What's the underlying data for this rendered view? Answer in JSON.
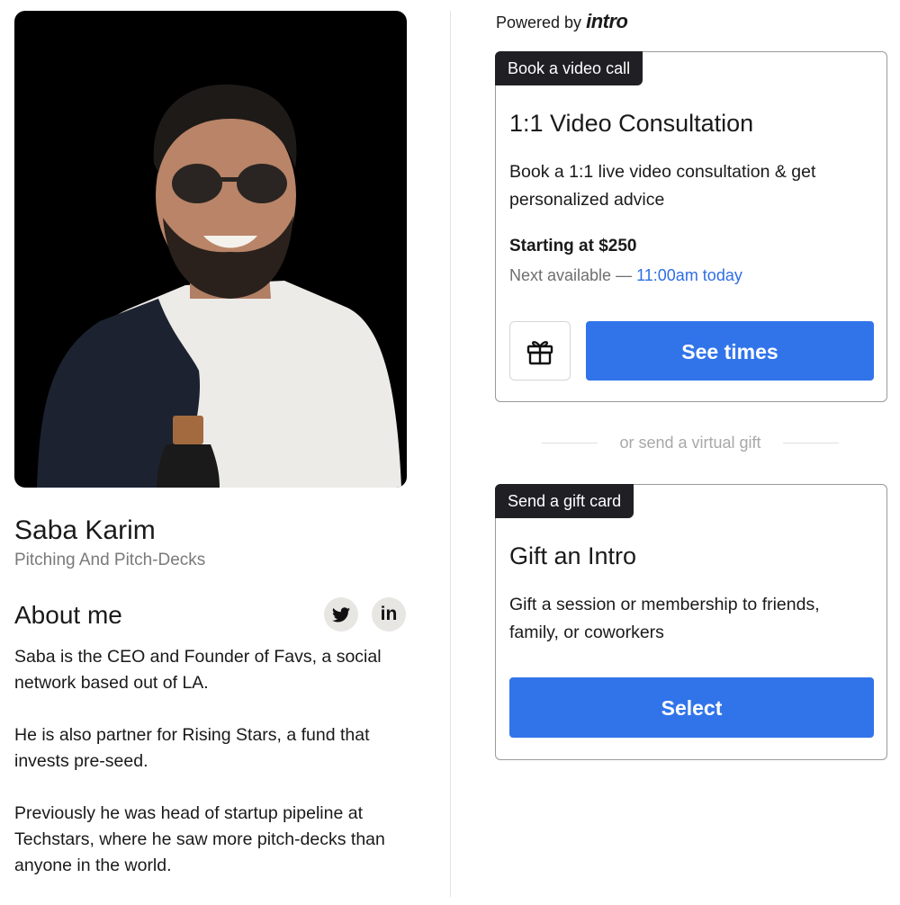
{
  "profile": {
    "name": "Saba Karim",
    "subtitle": "Pitching And Pitch-Decks"
  },
  "about": {
    "heading": "About me",
    "social_twitter_icon": "twitter-icon",
    "social_linkedin_label": "in",
    "bio": [
      "Saba is the CEO and Founder of Favs, a social network based out of LA.",
      "He is also partner for Rising Stars, a fund that invests pre-seed.",
      "Previously he was head of startup pipeline at Techstars, where he saw more pitch-decks than anyone in the world."
    ]
  },
  "powered": {
    "prefix": "Powered by",
    "brand": "intro"
  },
  "video_card": {
    "tag": "Book a video call",
    "title": "1:1 Video Consultation",
    "description": "Book a 1:1 live video consultation & get personalized advice",
    "price": "Starting at $250",
    "next_available_prefix": "Next available —",
    "next_available_time": "11:00am today",
    "gift_icon": "gift-icon",
    "button_label": "See times"
  },
  "divider_text": "or send a virtual gift",
  "gift_card": {
    "tag": "Send a gift card",
    "title": "Gift an Intro",
    "description": "Gift a session or membership to friends, family, or coworkers",
    "button_label": "Select"
  },
  "colors": {
    "accent": "#3174ea",
    "link": "#2e6ee6",
    "tag_bg": "#1f1f24"
  }
}
